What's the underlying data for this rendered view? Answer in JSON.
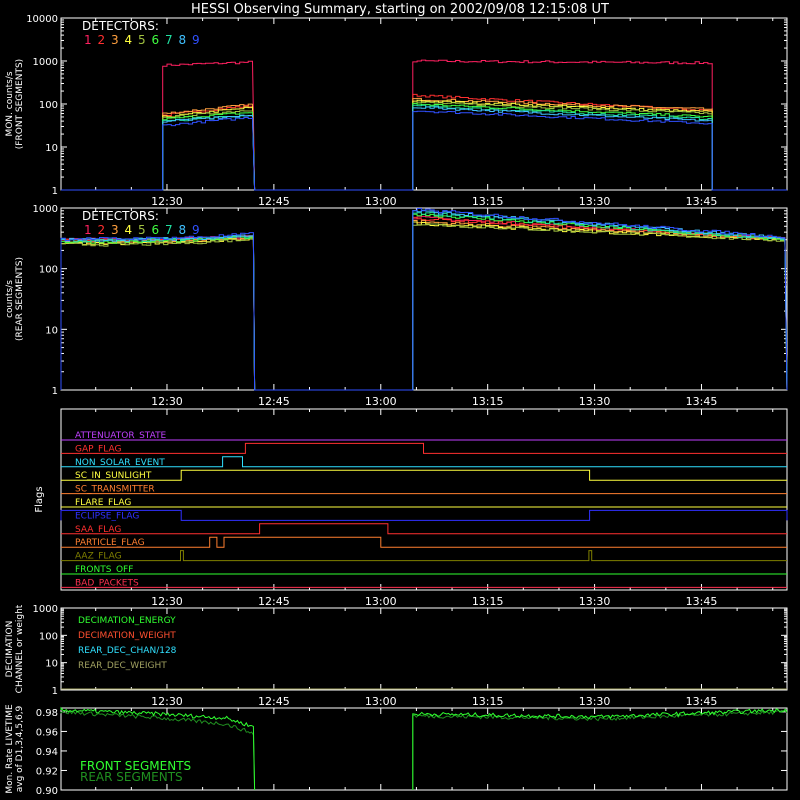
{
  "title": "HESSI Observing Summary, starting on 2002/09/08 12:15:08 UT",
  "detectors_label": "DETECTORS:",
  "detector_numbers": [
    "1",
    "2",
    "3",
    "4",
    "5",
    "6",
    "7",
    "8",
    "9"
  ],
  "colors": {
    "background": "#000000",
    "axes": "#ffffff",
    "detectors": [
      "#ff2060",
      "#ff3030",
      "#ffa040",
      "#ffff40",
      "#a0c040",
      "#40ff40",
      "#20e0a0",
      "#40c0ff",
      "#3050ff"
    ]
  },
  "time_axis": {
    "start_minutes": 15.13,
    "end_minutes": 117.0,
    "ticks": [
      {
        "minute": 30,
        "label": "12:30"
      },
      {
        "minute": 45,
        "label": "12:45"
      },
      {
        "minute": 60,
        "label": "13:00"
      },
      {
        "minute": 75,
        "label": "13:15"
      },
      {
        "minute": 90,
        "label": "13:30"
      },
      {
        "minute": 105,
        "label": "13:45"
      }
    ]
  },
  "chart_data": [
    {
      "type": "line",
      "ylabel_lines": [
        "MON. counts/s",
        "(FRONT SEGMENTS)"
      ],
      "yscale": "log",
      "ylim": [
        1,
        10000
      ],
      "yticks": [
        {
          "v": 1,
          "label": "1"
        },
        {
          "v": 10,
          "label": "10"
        },
        {
          "v": 100,
          "label": "100"
        },
        {
          "v": 1000,
          "label": "1000"
        },
        {
          "v": 10000,
          "label": "10000"
        }
      ],
      "data_intervals": [
        [
          29.4,
          42.3
        ],
        [
          64.5,
          106.5
        ]
      ],
      "series": [
        {
          "index": 0,
          "start": [
            800,
            950
          ],
          "end": [
            1000,
            900
          ]
        },
        {
          "index": 1,
          "start": [
            55,
            95
          ],
          "end": [
            160,
            70
          ]
        },
        {
          "index": 2,
          "start": [
            60,
            100
          ],
          "end": [
            130,
            75
          ]
        },
        {
          "index": 3,
          "start": [
            50,
            85
          ],
          "end": [
            120,
            65
          ]
        },
        {
          "index": 4,
          "start": [
            48,
            75
          ],
          "end": [
            110,
            60
          ]
        },
        {
          "index": 5,
          "start": [
            45,
            65
          ],
          "end": [
            100,
            50
          ]
        },
        {
          "index": 6,
          "start": [
            40,
            55
          ],
          "end": [
            90,
            45
          ]
        },
        {
          "index": 7,
          "start": [
            40,
            55
          ],
          "end": [
            85,
            40
          ]
        },
        {
          "index": 8,
          "start": [
            32,
            50
          ],
          "end": [
            70,
            35
          ]
        }
      ]
    },
    {
      "type": "line",
      "ylabel_lines": [
        "counts/s",
        "(REAR SEGMENTS)"
      ],
      "yscale": "log",
      "ylim": [
        1,
        1000
      ],
      "yticks": [
        {
          "v": 1,
          "label": "1"
        },
        {
          "v": 10,
          "label": "10"
        },
        {
          "v": 100,
          "label": "100"
        },
        {
          "v": 1000,
          "label": "1000"
        }
      ],
      "data_intervals": [
        [
          15.13,
          42.3
        ],
        [
          64.5,
          117.0
        ]
      ],
      "series": [
        {
          "index": 0,
          "start": [
            300,
            350
          ],
          "end": [
            700,
            310
          ]
        },
        {
          "index": 1,
          "start": [
            290,
            340
          ],
          "end": [
            680,
            305
          ]
        },
        {
          "index": 2,
          "start": [
            270,
            330
          ],
          "end": [
            600,
            300
          ]
        },
        {
          "index": 3,
          "start": [
            260,
            320
          ],
          "end": [
            560,
            295
          ]
        },
        {
          "index": 4,
          "start": [
            250,
            320
          ],
          "end": [
            550,
            290
          ]
        },
        {
          "index": 5,
          "start": [
            280,
            340
          ],
          "end": [
            800,
            300
          ]
        },
        {
          "index": 6,
          "start": [
            290,
            350
          ],
          "end": [
            850,
            300
          ]
        },
        {
          "index": 7,
          "start": [
            300,
            360
          ],
          "end": [
            900,
            320
          ]
        },
        {
          "index": 8,
          "start": [
            310,
            380
          ],
          "end": [
            950,
            330
          ]
        }
      ]
    }
  ],
  "flags_panel": {
    "ylabel": "Flags",
    "flags": [
      {
        "name": "ATTENUATOR_STATE",
        "color": "#c040ff",
        "level": 0,
        "highs": []
      },
      {
        "name": "GAP_FLAG",
        "color": "#ff3030",
        "level": 1,
        "highs": [
          [
            41.0,
            66.0
          ]
        ]
      },
      {
        "name": "NON_SOLAR_EVENT",
        "color": "#30e0ff",
        "level": 2,
        "highs": [
          [
            37.8,
            40.6
          ]
        ]
      },
      {
        "name": "SC_IN_SUNLIGHT",
        "color": "#ffff40",
        "level": 3,
        "highs": [
          [
            32.0,
            89.3
          ]
        ]
      },
      {
        "name": "SC_TRANSMITTER",
        "color": "#ff7f30",
        "level": 4,
        "highs": []
      },
      {
        "name": "FLARE_FLAG",
        "color": "#ffff40",
        "level": 5,
        "highs": []
      },
      {
        "name": "ECLIPSE_FLAG",
        "color": "#3030ff",
        "level": 6,
        "highs": [
          [
            15.13,
            32.0
          ],
          [
            89.3,
            117.0
          ]
        ]
      },
      {
        "name": "SAA_FLAG",
        "color": "#ff3030",
        "level": 7,
        "highs": [
          [
            43.0,
            61.0
          ]
        ]
      },
      {
        "name": "PARTICLE_FLAG",
        "color": "#ff7f30",
        "level": 8,
        "highs": [
          [
            36.0,
            37.0
          ],
          [
            38.0,
            60.0
          ]
        ]
      },
      {
        "name": "AAZ_FLAG",
        "color": "#808000",
        "level": 9,
        "highs": [
          [
            31.9,
            32.3
          ],
          [
            89.2,
            89.6
          ]
        ]
      },
      {
        "name": "FRONTS_OFF",
        "color": "#30ff30",
        "level": 10,
        "highs": []
      },
      {
        "name": "BAD_PACKETS",
        "color": "#ff3050",
        "level": 11,
        "highs": []
      }
    ]
  },
  "decimation_panel": {
    "ylabel_lines": [
      "DECIMATION",
      "CHANNEL or weight"
    ],
    "yticks": [
      {
        "v": 1,
        "label": "1"
      },
      {
        "v": 10,
        "label": "10"
      },
      {
        "v": 100,
        "label": "100"
      },
      {
        "v": 1000,
        "label": "1000"
      }
    ],
    "legend": [
      {
        "name": "DECIMATION_ENERGY",
        "color": "#30ff30"
      },
      {
        "name": "DECIMATION_WEIGHT",
        "color": "#ff5030"
      },
      {
        "name": "REAR_DEC_CHAN/128",
        "color": "#30e0ff"
      },
      {
        "name": "REAR_DEC_WEIGHT",
        "color": "#a0a060"
      }
    ]
  },
  "livetime_panel": {
    "ylabel_lines": [
      "Mon. Rate LIVETIME",
      "avg of D1,3,4,5,6,9"
    ],
    "ylim": [
      0.9,
      0.98
    ],
    "yticks": [
      {
        "v": 0.9,
        "label": "0.90"
      },
      {
        "v": 0.92,
        "label": "0.92"
      },
      {
        "v": 0.94,
        "label": "0.94"
      },
      {
        "v": 0.96,
        "label": "0.96"
      },
      {
        "v": 0.98,
        "label": "0.98"
      }
    ],
    "legend": [
      {
        "name": "FRONT SEGMENTS",
        "color": "#30ff30"
      },
      {
        "name": "REAR SEGMENTS",
        "color": "#209020"
      }
    ],
    "intervals": [
      {
        "range": [
          15.13,
          42.3
        ],
        "front": [
          0.982,
          0.978,
          0.972
        ],
        "rear": [
          0.98,
          0.974,
          0.965
        ]
      },
      {
        "range": [
          64.5,
          117.0
        ],
        "front": [
          0.978,
          0.975,
          0.982
        ],
        "rear": [
          0.976,
          0.973,
          0.98
        ]
      }
    ]
  }
}
